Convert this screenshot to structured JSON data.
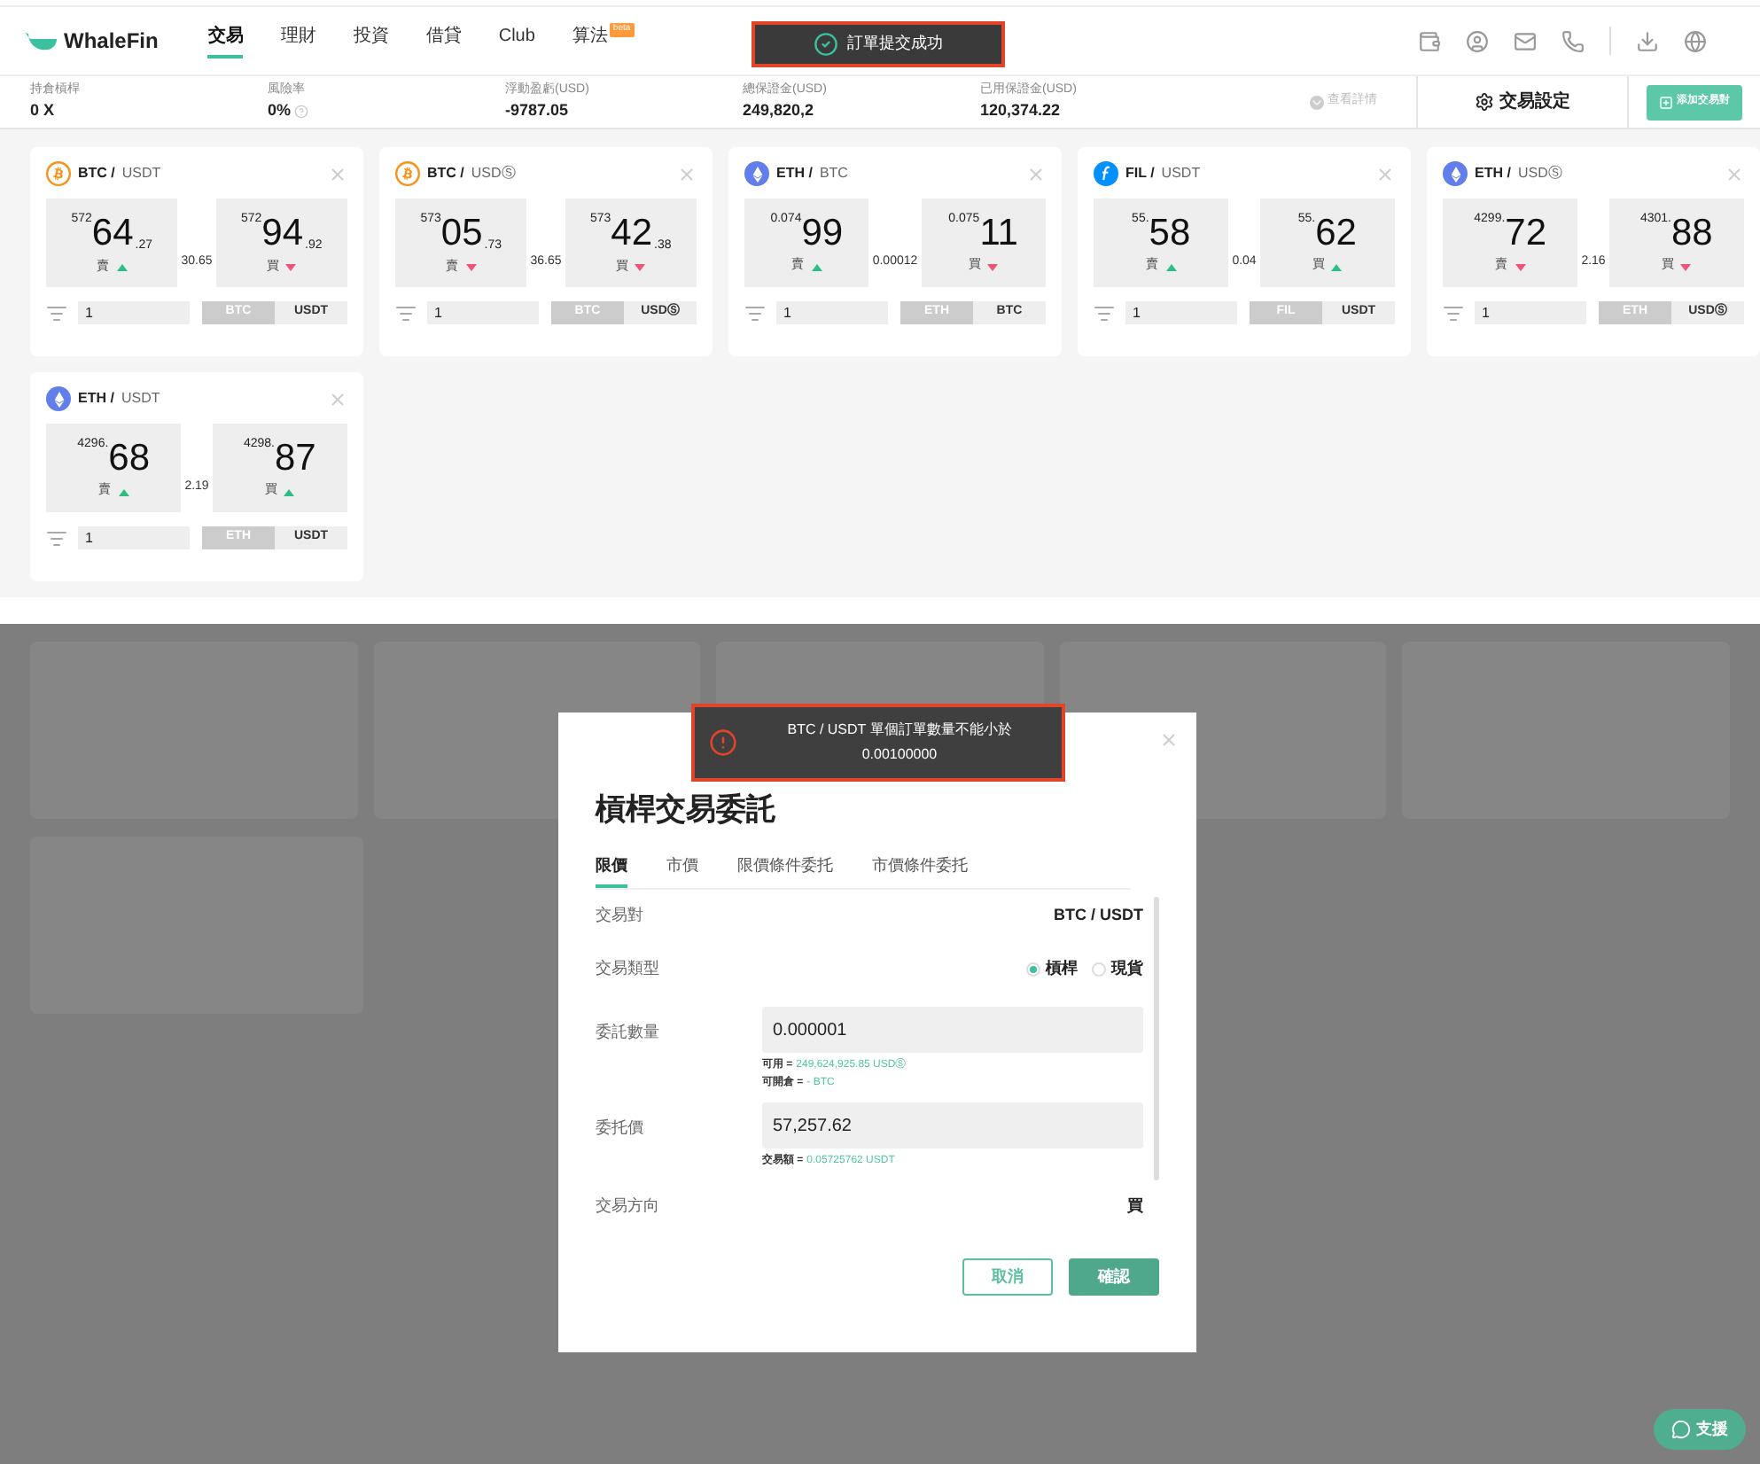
{
  "nav": {
    "brand": "WhaleFin",
    "tabs": [
      {
        "label": "交易",
        "selected": true
      },
      {
        "label": "理財",
        "selected": false
      },
      {
        "label": "投資",
        "selected": false
      },
      {
        "label": "借貸",
        "selected": false
      },
      {
        "label": "Club",
        "selected": false
      },
      {
        "label": "算法",
        "selected": false,
        "badge": "beta"
      }
    ]
  },
  "toast": {
    "text": "訂單提交成功"
  },
  "stats": [
    {
      "label": "持倉槓桿",
      "value": "0 X",
      "help": false
    },
    {
      "label": "風險率",
      "value": "0%",
      "help": true
    },
    {
      "label": "浮動盈虧(USD)",
      "value": "-9787.05",
      "help": false
    },
    {
      "label": "總保證金(USD)",
      "value": "249,820,2",
      "help": false
    },
    {
      "label": "已用保證金(USD)",
      "value": "120,374.22",
      "help": false
    }
  ],
  "details_link": "查看詳情",
  "settings_button": "交易設定",
  "add_pair_button": "添加交易對",
  "cards": [
    {
      "kind": "btc",
      "base": "BTC /",
      "quote": "USDT",
      "sell": {
        "label": "賣",
        "prefix": "572",
        "main": "64",
        "tail": ".27",
        "rising": true
      },
      "spread": "30.65",
      "buy": {
        "label": "買",
        "prefix": "572",
        "main": "94",
        "tail": ".92",
        "rising": false
      },
      "quantity": "1",
      "units": [
        {
          "label": "BTC",
          "selected": true
        },
        {
          "label": "USDT",
          "selected": false
        }
      ]
    },
    {
      "kind": "btc",
      "base": "BTC /",
      "quote": "USDⓈ",
      "sell": {
        "label": "賣",
        "prefix": "573",
        "main": "05",
        "tail": ".73",
        "rising": false
      },
      "spread": "36.65",
      "buy": {
        "label": "買",
        "prefix": "573",
        "main": "42",
        "tail": ".38",
        "rising": false
      },
      "quantity": "1",
      "units": [
        {
          "label": "BTC",
          "selected": true
        },
        {
          "label": "USDⓈ",
          "selected": false
        }
      ]
    },
    {
      "kind": "eth",
      "base": "ETH /",
      "quote": "BTC",
      "sell": {
        "label": "賣",
        "prefix": "0.074",
        "main": "99",
        "rising": true
      },
      "spread": "0.00012",
      "buy": {
        "label": "買",
        "prefix": "0.075",
        "main": "11",
        "rising": false
      },
      "quantity": "1",
      "units": [
        {
          "label": "ETH",
          "selected": true
        },
        {
          "label": "BTC",
          "selected": false
        }
      ]
    },
    {
      "kind": "fil",
      "base": "FIL /",
      "quote": "USDT",
      "sell": {
        "label": "賣",
        "prefix": "55.",
        "main": "58",
        "rising": true
      },
      "spread": "0.04",
      "buy": {
        "label": "買",
        "prefix": "55.",
        "main": "62",
        "rising": true
      },
      "quantity": "1",
      "units": [
        {
          "label": "FIL",
          "selected": true
        },
        {
          "label": "USDT",
          "selected": false
        }
      ]
    },
    {
      "kind": "eth",
      "base": "ETH /",
      "quote": "USDⓈ",
      "sell": {
        "label": "賣",
        "prefix": "4299.",
        "main": "72",
        "rising": false
      },
      "spread": "2.16",
      "buy": {
        "label": "買",
        "prefix": "4301.",
        "main": "88",
        "rising": false
      },
      "quantity": "1",
      "units": [
        {
          "label": "ETH",
          "selected": true
        },
        {
          "label": "USDⓈ",
          "selected": false
        }
      ]
    },
    {
      "kind": "eth",
      "base": "ETH /",
      "quote": "USDT",
      "sell": {
        "label": "賣",
        "prefix": "4296.",
        "main": "68",
        "rising": true
      },
      "spread": "2.19",
      "buy": {
        "label": "買",
        "prefix": "4298.",
        "main": "87",
        "rising": true
      },
      "quantity": "1",
      "units": [
        {
          "label": "ETH",
          "selected": true
        },
        {
          "label": "USDT",
          "selected": false
        }
      ]
    }
  ],
  "error_toast": {
    "lines": [
      "BTC / USDT 單個訂單數量不能小於",
      "0.00100000"
    ]
  },
  "modal": {
    "title": "槓桿交易委託",
    "tabs": [
      {
        "label": "限價",
        "selected": true
      },
      {
        "label": "市價",
        "selected": false
      },
      {
        "label": "限價條件委托",
        "selected": false
      },
      {
        "label": "市價條件委托",
        "selected": false
      }
    ],
    "pair": {
      "label": "交易對",
      "value": "BTC / USDT"
    },
    "type": {
      "label": "交易類型",
      "options": [
        {
          "label": "槓桿",
          "selected": true
        },
        {
          "label": "現貨",
          "selected": false
        }
      ]
    },
    "quantity": {
      "label": "委託數量",
      "value": "0.000001",
      "notes": [
        {
          "label": "可用 =",
          "value": "249,624,925.85 USDⓈ"
        },
        {
          "label": "可開倉 =",
          "value": "- BTC"
        }
      ]
    },
    "price": {
      "label": "委托價",
      "value": "57,257.62",
      "notes": [
        {
          "label": "交易額 =",
          "value": "0.05725762 USDT"
        }
      ]
    },
    "direction": {
      "label": "交易方向",
      "value": "買"
    },
    "cancel": "取消",
    "confirm": "確認"
  },
  "support_button": "支援"
}
